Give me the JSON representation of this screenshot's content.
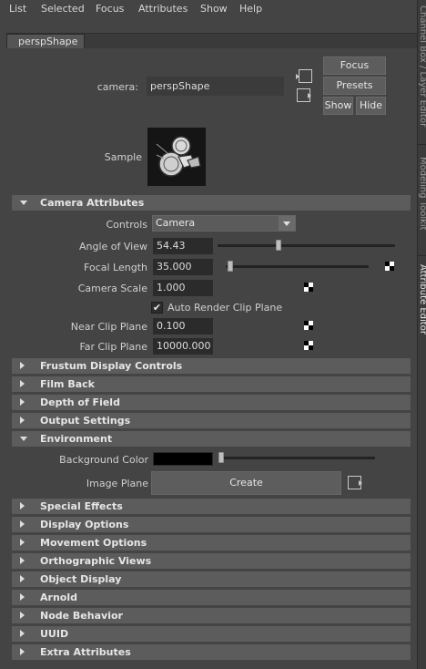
{
  "menu": [
    "List",
    "Selected",
    "Focus",
    "Attributes",
    "Show",
    "Help"
  ],
  "node_tab": "perspShape",
  "side_tabs": [
    "Channel Box / Layer Editor",
    "Modeling Toolkit",
    "Attribute Editor"
  ],
  "header": {
    "camera_label": "camera:",
    "camera_value": "perspShape",
    "focus": "Focus",
    "presets": "Presets",
    "show": "Show",
    "hide": "Hide",
    "sample_label": "Sample"
  },
  "camera_attributes": {
    "title": "Camera Attributes",
    "controls_label": "Controls",
    "controls_value": "Camera",
    "angle_label": "Angle of View",
    "angle_value": "54.43",
    "angle_slider_fraction": 0.33,
    "focal_label": "Focal Length",
    "focal_value": "35.000",
    "focal_slider_fraction": 0.01,
    "scale_label": "Camera Scale",
    "scale_value": "1.000",
    "auto_clip_label": "Auto Render Clip Plane",
    "auto_clip_checked": true,
    "near_label": "Near Clip Plane",
    "near_value": "0.100",
    "far_label": "Far Clip Plane",
    "far_value": "10000.000"
  },
  "collapsed_sections_top": [
    "Frustum Display Controls",
    "Film Back",
    "Depth of Field",
    "Output Settings"
  ],
  "environment": {
    "title": "Environment",
    "bg_color_label": "Background Color",
    "bg_color_value": "#000000",
    "bg_slider_fraction": 0.0,
    "image_plane_label": "Image Plane",
    "create_label": "Create"
  },
  "collapsed_sections_bottom": [
    "Special Effects",
    "Display Options",
    "Movement Options",
    "Orthographic Views",
    "Object Display",
    "Arnold",
    "Node Behavior",
    "UUID",
    "Extra Attributes"
  ],
  "colors": {
    "background": "#444444",
    "section_header": "#5c5c5c",
    "field": "#2b2b2b"
  }
}
